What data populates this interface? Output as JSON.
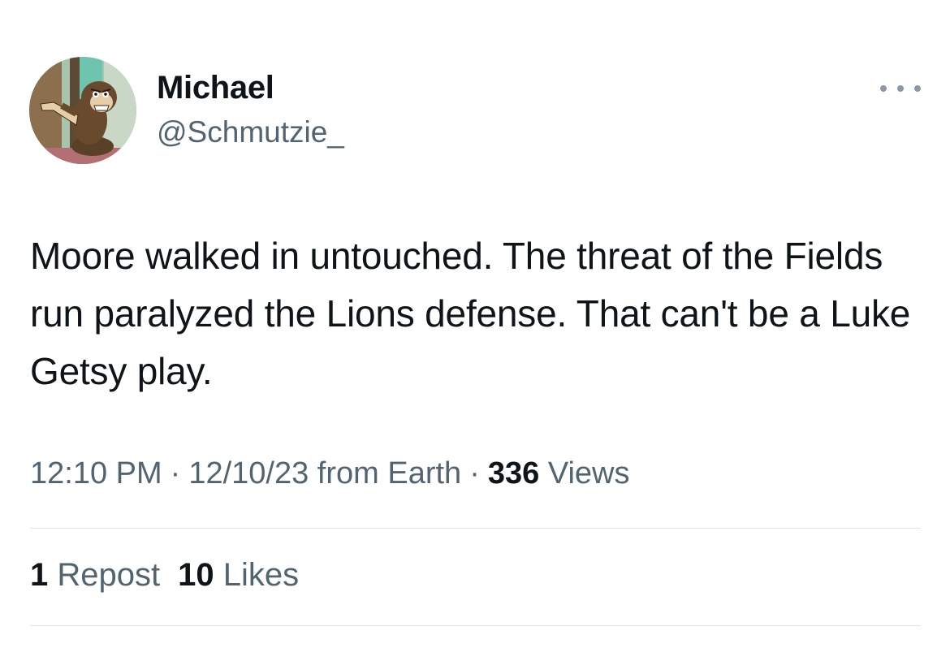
{
  "author": {
    "display_name": "Michael",
    "handle": "@Schmutzie_",
    "avatar_icon": "cartoon-monkey-avatar"
  },
  "more_icon": "more-horizontal-icon",
  "tweet": {
    "text": "Moore walked in untouched. The threat of the Fields run paralyzed the Lions defense. That can't be a Luke Getsy play."
  },
  "meta": {
    "time": "12:10 PM",
    "separator": "·",
    "date": "12/10/23",
    "location": "from Earth",
    "views_count": "336",
    "views_label": "Views"
  },
  "stats": {
    "reposts_count": "1",
    "reposts_label": "Repost",
    "likes_count": "10",
    "likes_label": "Likes"
  },
  "colors": {
    "text_primary": "#0f1419",
    "text_secondary": "#536471",
    "divider": "#e1e6ea",
    "background": "#ffffff"
  }
}
